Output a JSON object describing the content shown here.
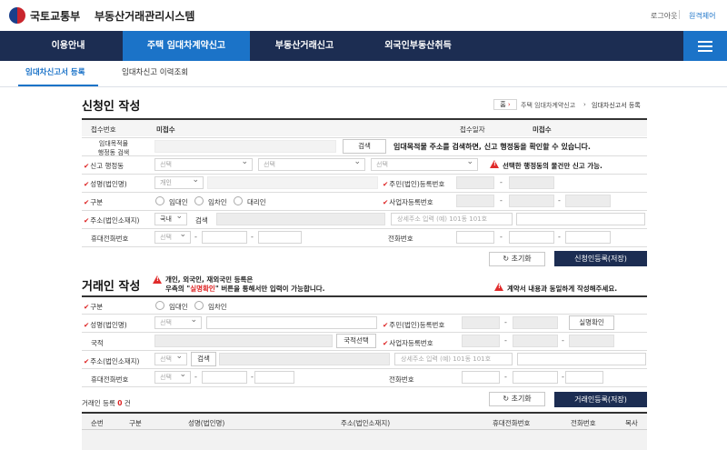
{
  "header": {
    "ministry": "국토교통부",
    "system_name": "부동산거래관리시스템",
    "logout": "로그아웃",
    "remote_support": "원격제어"
  },
  "nav": {
    "items": [
      "이용안내",
      "주택 임대차계약신고",
      "부동산거래신고",
      "외국인부동산취득"
    ],
    "active": "주택 임대차계약신고"
  },
  "subnav": {
    "items": [
      "임대차신고서 등록",
      "임대차신고 이력조회"
    ],
    "active": "임대차신고서 등록"
  },
  "applicant": {
    "title": "신청인 작성",
    "breadcrumb": {
      "home": "홈",
      "level1": "주택 임대차계약신고",
      "level2": "임대차신고서 등록"
    },
    "receipt_no_label": "접수번호",
    "receipt_no_value": "미접수",
    "receipt_date_label": "접수일자",
    "receipt_date_value": "미접수",
    "address_search_label1": "임대목적물",
    "address_search_label2": "행정동 검색",
    "search_button": "검색",
    "address_search_note": "임대목적물 주소를 검색하면, 신고 행정동을 확인할 수 있습니다.",
    "admin_dong_label": "신고 행정동",
    "select_placeholder": "선택",
    "admin_dong_warning": "선택한 행정동의 물건만 신고 가능.",
    "name_label": "성명(법인명)",
    "name_value": "개인",
    "reg_no_label": "주민(법인)등록번호",
    "type_label": "구분",
    "type_options": [
      "임대인",
      "임차인",
      "대리인"
    ],
    "biz_no_label": "사업자등록번호",
    "address_label": "주소(법인소재지)",
    "country_value": "국내",
    "detail_placeholder": "상세주소 입력 (예) 101동 101호",
    "mobile_label": "휴대전화번호",
    "phone_label": "전화번호",
    "reset_button": "초기화",
    "save_button": "신청인등록(저장)"
  },
  "counterparty": {
    "title": "거래인 작성",
    "note_line1": "개인, 외국인, 재외국민 등록은",
    "note_line2_pre": "우측의 \"",
    "note_line2_highlight": "실명확인",
    "note_line2_post": "\" 버튼을 통해서만 입력이 가능합니다.",
    "note_right": "계약서 내용과 동일하게 작성해주세요.",
    "type_label": "구분",
    "type_options": [
      "임대인",
      "임차인"
    ],
    "name_label": "성명(법인명)",
    "reg_no_label": "주민(법인)등록번호",
    "verify_button": "실명확인",
    "nationality_label": "국적",
    "nationality_button": "국적선택",
    "biz_no_label": "사업자등록번호",
    "address_label": "주소(법인소재지)",
    "search_button": "검색",
    "detail_placeholder": "상세주소 입력 (예) 101동 101호",
    "mobile_label": "휴대전화번호",
    "phone_label": "전화번호",
    "count_prefix": "거래인 등록",
    "count_value": "0",
    "count_suffix": "건",
    "reset_button": "초기화",
    "save_button": "거래인등록(저장)",
    "table_headers": [
      "순번",
      "구분",
      "성명(법인명)",
      "주소(법인소재지)",
      "휴대전화번호",
      "전화번호",
      "복사"
    ]
  }
}
